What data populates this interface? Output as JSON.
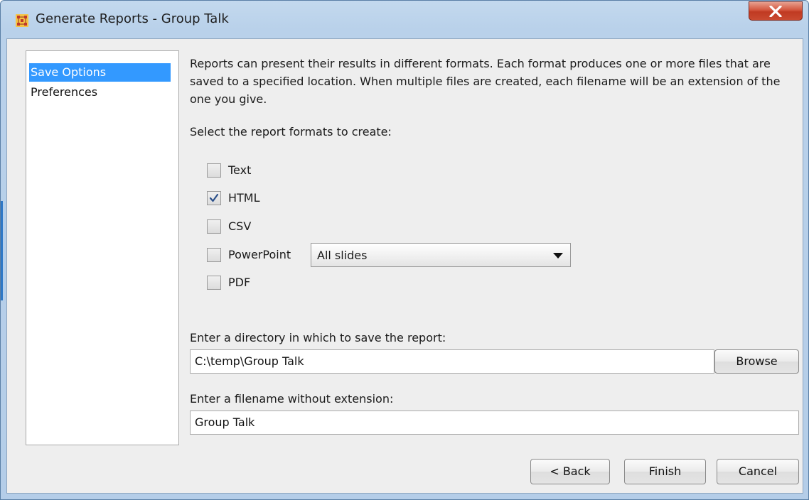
{
  "window": {
    "title": "Generate Reports - Group Talk",
    "close_label": "X"
  },
  "nav": {
    "items": [
      {
        "label": "Save Options",
        "selected": true
      },
      {
        "label": "Preferences",
        "selected": false
      }
    ]
  },
  "main": {
    "intro": "Reports can present their results in different formats. Each format produces one or more files that are saved to a specified location. When multiple files are created, each filename will be an extension of the one you give.",
    "formats_heading": "Select the report formats to create:",
    "formats": [
      {
        "label": "Text",
        "checked": false
      },
      {
        "label": "HTML",
        "checked": true
      },
      {
        "label": "CSV",
        "checked": false
      },
      {
        "label": "PowerPoint",
        "checked": false
      },
      {
        "label": "PDF",
        "checked": false
      }
    ],
    "powerpoint_option": "All slides",
    "directory_label": "Enter a directory in which to save the report:",
    "directory_value": "C:\\temp\\Group Talk",
    "browse_label": "Browse",
    "filename_label": "Enter a filename without extension:",
    "filename_value": "Group Talk"
  },
  "footer": {
    "back_label": "< Back",
    "finish_label": "Finish",
    "cancel_label": "Cancel"
  },
  "colors": {
    "selection": "#3399ff",
    "close_button": "#c94a30",
    "dialog_bg": "#eeeeee"
  }
}
